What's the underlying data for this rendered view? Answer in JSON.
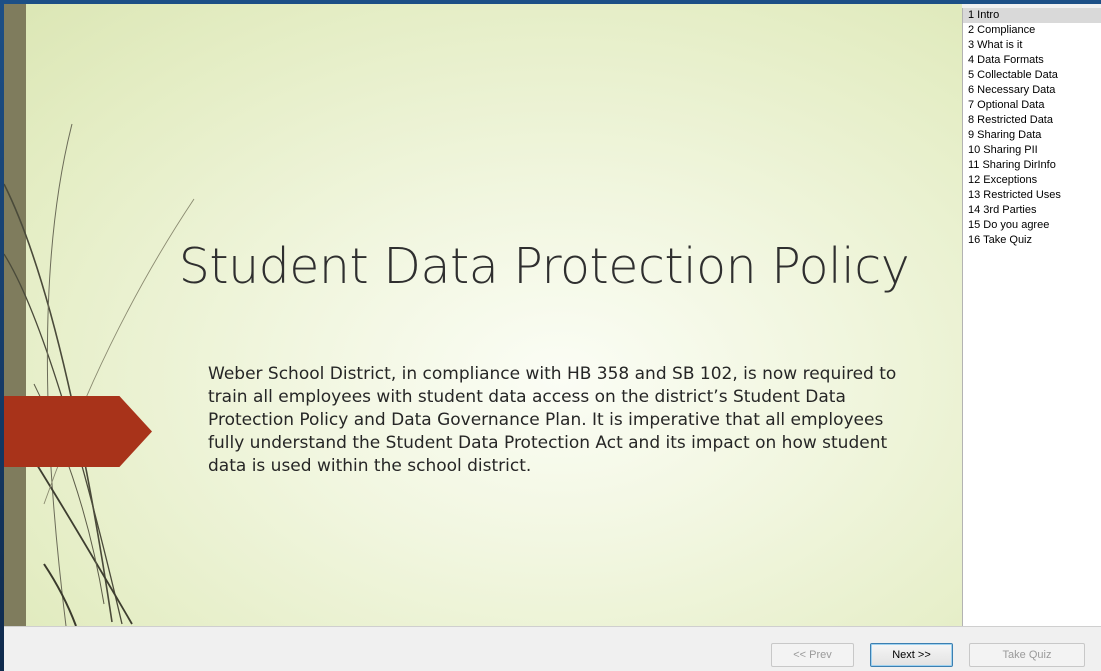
{
  "slide": {
    "title": "Student Data Protection Policy",
    "body": "Weber School District, in compliance with HB 358 and SB 102, is now required to train all employees with student data access on the district’s Student Data Protection Policy and Data Governance Plan.  It is imperative that all employees fully understand the Student Data Protection Act and its impact on how student data is used within the school district."
  },
  "slide_list": {
    "selected_index": 0,
    "items": [
      "1 Intro",
      "2 Compliance",
      "3 What is it",
      "4 Data Formats",
      "5 Collectable Data",
      "6 Necessary Data",
      "7 Optional Data",
      "8 Restricted Data",
      "9 Sharing Data",
      "10 Sharing PII",
      "11 Sharing DirInfo",
      "12 Exceptions",
      "13 Restricted Uses",
      "14 3rd Parties",
      "15 Do you agree",
      "16 Take Quiz"
    ]
  },
  "nav": {
    "prev_label": "<< Prev",
    "next_label": "Next >>",
    "quiz_label": "Take Quiz"
  },
  "colors": {
    "accent_arrow": "#a8331a",
    "left_bar": "#7f7c5d",
    "slide_bg": "#eef4d9",
    "list_selected": "#d9d9d9",
    "desktop_bg": "#1c4f86"
  }
}
